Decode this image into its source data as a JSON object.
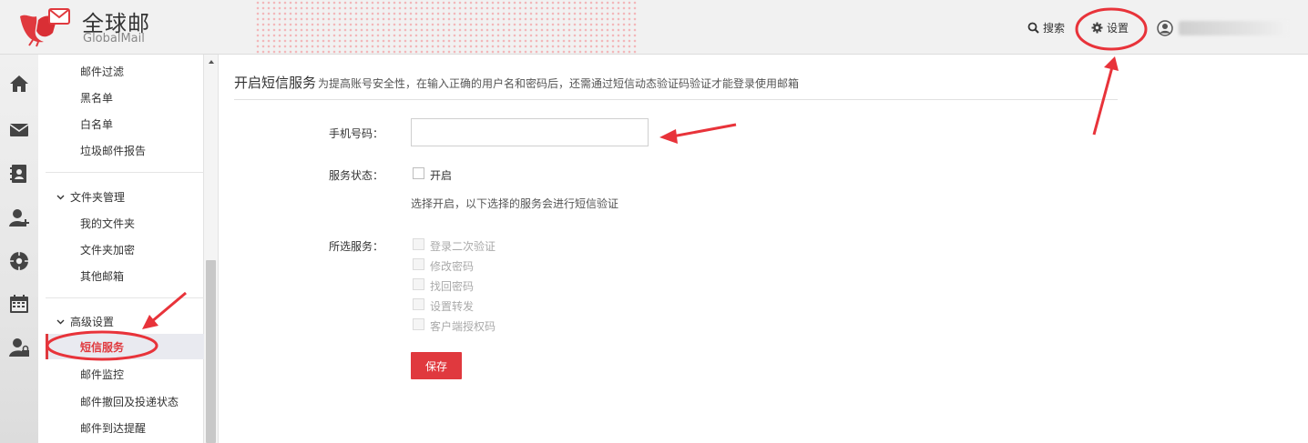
{
  "header": {
    "brand_cn": "全球邮",
    "brand_en": "GlobalMail",
    "search_label": "搜索",
    "settings_label": "设置"
  },
  "rail": {
    "icons": [
      "home-icon",
      "mail-icon",
      "contacts-icon",
      "add-user-icon",
      "disk-icon",
      "calendar-icon",
      "user-lock-icon"
    ]
  },
  "menu": {
    "items_top": [
      "邮件过滤",
      "黑名单",
      "白名单",
      "垃圾邮件报告"
    ],
    "folder_section": "文件夹管理",
    "folder_items": [
      "我的文件夹",
      "文件夹加密",
      "其他邮箱"
    ],
    "advanced_section": "高级设置",
    "active_item": "短信服务",
    "advanced_items": [
      "邮件监控",
      "邮件撤回及投递状态",
      "邮件到达提醒"
    ]
  },
  "content": {
    "title": "开启短信服务",
    "description": "为提高账号安全性，在输入正确的用户名和密码后，还需通过短信动态验证码验证才能登录使用邮箱",
    "phone_label": "手机号码：",
    "phone_value": "",
    "status_label": "服务状态：",
    "status_option": "开启",
    "hint": "选择开启，以下选择的服务会进行短信验证",
    "services_label": "所选服务：",
    "services": [
      "登录二次验证",
      "修改密码",
      "找回密码",
      "设置转发",
      "客户端授权码"
    ],
    "save_label": "保存"
  },
  "colors": {
    "accent": "#e0393e",
    "annotation": "#e8333a"
  }
}
